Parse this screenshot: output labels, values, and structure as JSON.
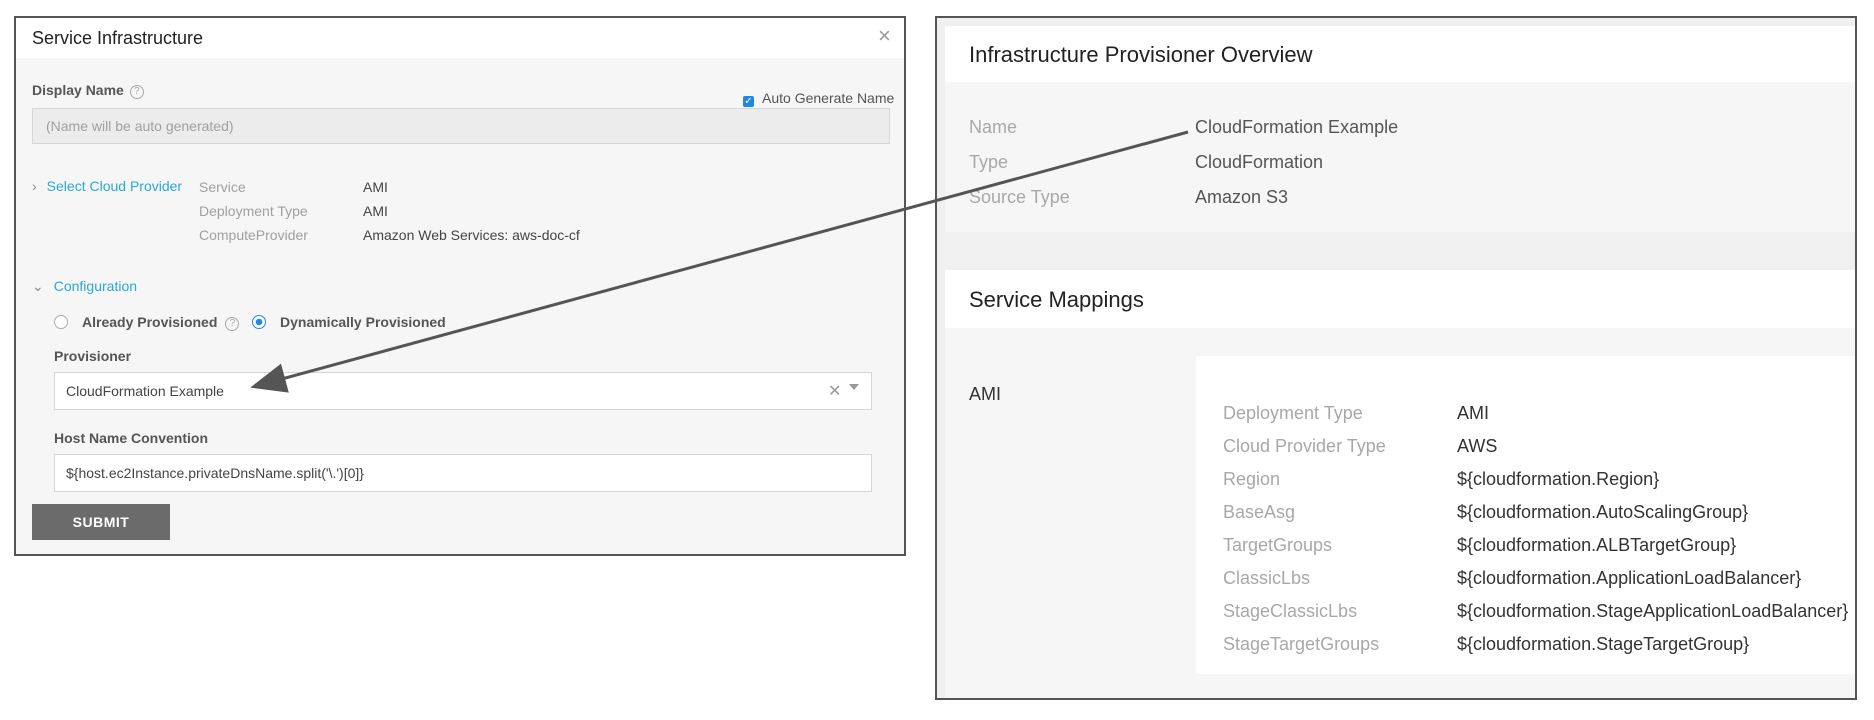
{
  "dialog": {
    "title": "Service Infrastructure",
    "close_glyph": "×",
    "display_name_label": "Display Name",
    "help_glyph": "?",
    "auto_generate_label": "Auto Generate Name",
    "auto_generate_checked": true,
    "name_placeholder": "(Name will be auto generated)",
    "select_cloud_provider": "Select Cloud Provider",
    "provider_fields": [
      {
        "label": "Service",
        "value": "AMI"
      },
      {
        "label": "Deployment Type",
        "value": "AMI"
      },
      {
        "label": "ComputeProvider",
        "value": "Amazon Web Services: aws-doc-cf"
      }
    ],
    "configuration_label": "Configuration",
    "radio_already": "Already Provisioned",
    "radio_dynamic": "Dynamically Provisioned",
    "selected_radio": "Dynamically Provisioned",
    "provisioner_label": "Provisioner",
    "provisioner_value": "CloudFormation Example",
    "host_name_label": "Host Name Convention",
    "host_name_value": "${host.ec2Instance.privateDnsName.split('\\.')[0]}",
    "submit_label": "SUBMIT",
    "icons": [
      "close-icon",
      "help-icon",
      "checkbox-icon",
      "chevron-right-icon",
      "chevron-down-icon",
      "clear-icon",
      "dropdown-caret-icon"
    ]
  },
  "overview": {
    "title": "Infrastructure Provisioner Overview",
    "rows": [
      {
        "label": "Name",
        "value": "CloudFormation Example"
      },
      {
        "label": "Type",
        "value": "CloudFormation"
      },
      {
        "label": "Source Type",
        "value": "Amazon S3"
      }
    ]
  },
  "mappings": {
    "title": "Service Mappings",
    "service": "AMI",
    "rows": [
      {
        "label": "Deployment Type",
        "value": "AMI"
      },
      {
        "label": "Cloud Provider Type",
        "value": "AWS"
      },
      {
        "label": "Region",
        "value": "${cloudformation.Region}"
      },
      {
        "label": "BaseAsg",
        "value": "${cloudformation.AutoScalingGroup}"
      },
      {
        "label": "TargetGroups",
        "value": "${cloudformation.ALBTargetGroup}"
      },
      {
        "label": "ClassicLbs",
        "value": "${cloudformation.ApplicationLoadBalancer}"
      },
      {
        "label": "StageClassicLbs",
        "value": "${cloudformation.StageApplicationLoadBalancer}"
      },
      {
        "label": "StageTargetGroups",
        "value": "${cloudformation.StageTargetGroup}"
      }
    ]
  },
  "colors": {
    "accent": "#1e88e5",
    "link": "#2aa8d8",
    "submit": "#6b6b6b",
    "arrow": "#555555"
  }
}
